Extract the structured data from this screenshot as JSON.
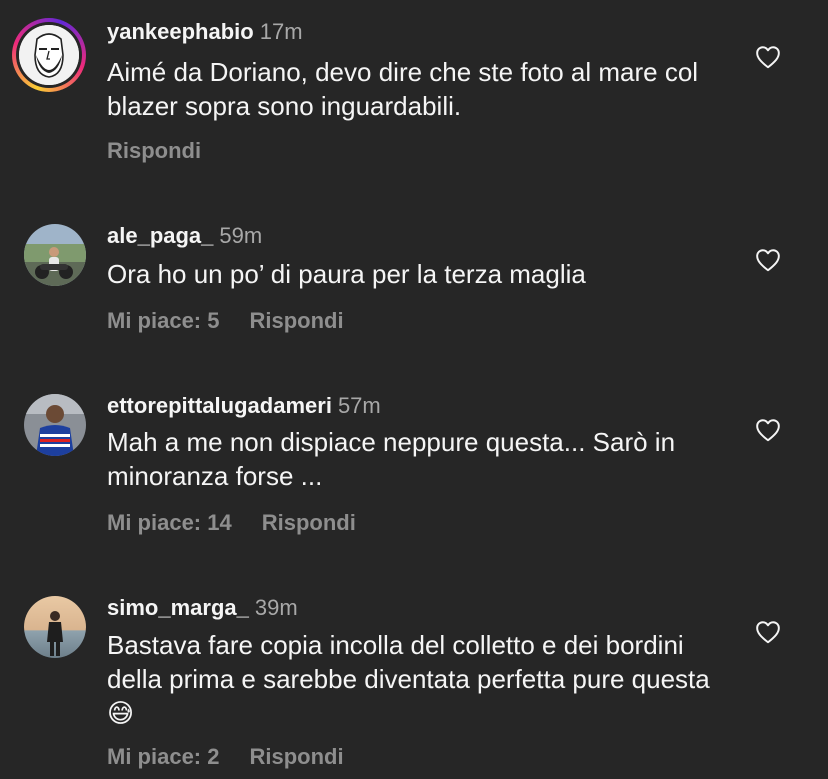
{
  "comments": [
    {
      "username": "yankeephabio",
      "time": "17m",
      "text": "Aimé da Doriano, devo dire che ste foto al mare col blazer sopra sono inguardabili.",
      "likes": "",
      "reply": "Rispondi"
    },
    {
      "username": "ale_paga_",
      "time": "59m",
      "text": "Ora ho un po’ di paura per la terza maglia",
      "likes": "Mi piace: 5",
      "reply": "Rispondi"
    },
    {
      "username": "ettorepittalugadameri",
      "time": "57m",
      "text": "Mah a me non dispiace neppure questa... Sarò in minoranza forse ...",
      "likes": "Mi piace: 14",
      "reply": "Rispondi"
    },
    {
      "username": "simo_marga_",
      "time": "39m",
      "text": "Bastava fare copia incolla del colletto e dei bordini della prima e sarebbe diventata perfetta pure questa 😅",
      "likes": "Mi piace: 2",
      "reply": "Rispondi"
    }
  ],
  "icons": {
    "like": "heart-outline-icon"
  },
  "colors": {
    "background": "#262626",
    "text": "#f5f5f5",
    "muted": "#a8a8a8"
  }
}
